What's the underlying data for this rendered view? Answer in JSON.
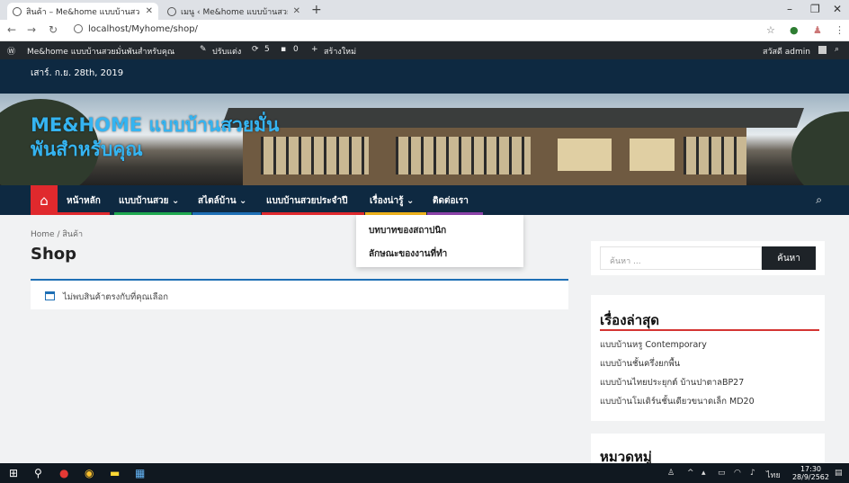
{
  "browser": {
    "tabs": [
      {
        "label": "สินค้า – Me&home แบบบ้านสวยมั่น"
      },
      {
        "label": "เมนู ‹ Me&home แบบบ้านสวยมั่นพั"
      }
    ],
    "url": "localhost/Myhome/shop/"
  },
  "admin_bar": {
    "site": "Me&home แบบบ้านสวยมั่นพันสำหรับคุณ",
    "customize": "ปรับแต่ง",
    "updates": "5",
    "comments": "0",
    "new": "สร้างใหม่",
    "greeting": "สวัสดี admin"
  },
  "header": {
    "date": "เสาร์. ก.ย. 28th, 2019",
    "site_title": "ME&HOME แบบบ้านสวยมั่นพันสำหรับคุณ"
  },
  "nav": {
    "items": [
      {
        "label": "หน้าหลัก",
        "color": "#e0292d"
      },
      {
        "label": "แบบบ้านสวย ⌄",
        "color": "#1fa84f"
      },
      {
        "label": "สไตล์บ้าน ⌄",
        "color": "#1e6fb5"
      },
      {
        "label": "แบบบ้านสวยประจำปี",
        "color": "#e0292d"
      },
      {
        "label": "เรื่องน่ารู้ ⌄",
        "color": "#f2b51b"
      },
      {
        "label": "ติดต่อเรา",
        "color": "#8e44ad"
      }
    ],
    "dropdown": [
      "บทบาทของสถาปนิก",
      "ลักษณะของงานที่ทำ"
    ]
  },
  "main": {
    "breadcrumb": "Home / สินค้า",
    "title": "Shop",
    "notice": "ไม่พบสินค้าตรงกับที่คุณเลือก"
  },
  "sidebar": {
    "search_placeholder": "ค้นหา ...",
    "search_button": "ค้นหา",
    "recent_title": "เรื่องล่าสุด",
    "recent_posts": [
      "แบบบ้านหรู Contemporary",
      "แบบบ้านชั้นครึ่งยกพื้น",
      "แบบบ้านไทยประยุกต์ บ้านปาตาลBP27",
      "แบบบ้านโมเดิร์นชั้นเดียวขนาดเล็ก MD20"
    ],
    "category_title": "หมวดหมู่"
  },
  "taskbar": {
    "lang": "ไทย",
    "time": "17:30",
    "date": "28/9/2562"
  }
}
